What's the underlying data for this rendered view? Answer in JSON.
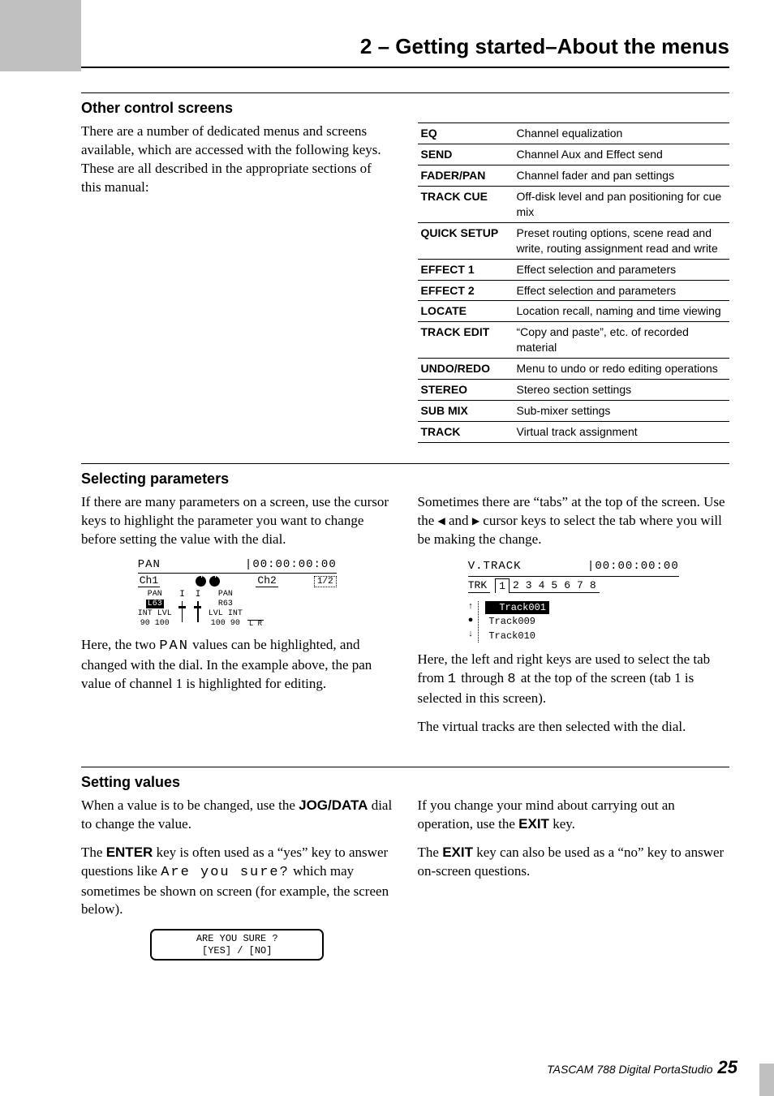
{
  "header": {
    "title": "2 – Getting started–About the menus"
  },
  "section_other": {
    "heading": "Other control screens",
    "intro": "There are a number of dedicated menus and screens available, which are accessed with the following keys. These are all described in the appropriate sections of this manual:"
  },
  "menu_table": [
    {
      "key": "EQ",
      "desc": "Channel equalization"
    },
    {
      "key": "SEND",
      "desc": "Channel Aux and Effect send"
    },
    {
      "key": "FADER/PAN",
      "desc": "Channel fader and pan settings"
    },
    {
      "key": "TRACK CUE",
      "desc": "Off-disk level and pan positioning for cue mix"
    },
    {
      "key": "QUICK SETUP",
      "desc": "Preset routing options, scene read and write, routing assignment read and write"
    },
    {
      "key": "EFFECT 1",
      "desc": "Effect selection and parameters"
    },
    {
      "key": "EFFECT 2",
      "desc": "Effect selection and parameters"
    },
    {
      "key": "LOCATE",
      "desc": "Location recall, naming and time viewing"
    },
    {
      "key": "TRACK EDIT",
      "desc": "“Copy and paste”, etc. of recorded material"
    },
    {
      "key": "UNDO/REDO",
      "desc": "Menu to undo or redo editing operations"
    },
    {
      "key": "STEREO",
      "desc": "Stereo section settings"
    },
    {
      "key": "SUB MIX",
      "desc": "Sub-mixer settings"
    },
    {
      "key": "TRACK",
      "desc": "Virtual track assignment"
    }
  ],
  "section_selecting": {
    "heading": "Selecting parameters",
    "left_p1": "If there are many parameters on a screen, use the cursor keys to highlight the parameter you want to change before setting the value with the dial.",
    "left_p2_a": "Here, the two ",
    "left_p2_mono": "PAN",
    "left_p2_b": " values can be highlighted, and changed with the dial. In the example above, the pan value of channel 1 is highlighted for editing.",
    "right_p1": "Sometimes there are “tabs” at the top of the screen. Use the ",
    "right_p1_mid": " and ",
    "right_p1_end": " cursor keys to select the tab where you will be making the change.",
    "right_p2_a": "Here, the left and right keys are used to select the tab from ",
    "right_p2_mono1": "1",
    "right_p2_mid": " through ",
    "right_p2_mono2": "8",
    "right_p2_b": " at the top of the screen (tab 1 is selected in this screen).",
    "right_p3": "The virtual tracks are then selected with the dial."
  },
  "pan_lcd": {
    "title": "PAN",
    "time": "|00:00:00:00",
    "ch1": "Ch1",
    "ch2": "Ch2",
    "page": "1/2",
    "pan_label": "PAN",
    "l63": "L63",
    "r63": "R63",
    "int_l": "INT",
    "lvl_l": "LVL",
    "ninety_l": "90",
    "hundred_l": "100",
    "lvl_r": "LVL",
    "int_r": "INT",
    "hundred_r": "100",
    "ninety_r": "90",
    "lr": "L R",
    "i_label": "I"
  },
  "vtrack_lcd": {
    "title": "V.TRACK",
    "time": "|00:00:00:00",
    "trk": "TRK",
    "tabs": [
      "1",
      "2",
      "3",
      "4",
      "5",
      "6",
      "7",
      "8"
    ],
    "rows": [
      "Track001",
      "Track009",
      "Track010"
    ]
  },
  "section_setting": {
    "heading": "Setting values",
    "left_p1_a": "When a value is to be changed, use the ",
    "left_p1_key": "JOG/DATA",
    "left_p1_b": " dial to change the value.",
    "left_p2_a": "The ",
    "left_p2_key": "ENTER",
    "left_p2_b": " key is often used as a “yes” key to answer questions like ",
    "left_p2_mono": "Are you sure?",
    "left_p2_c": " which may sometimes be shown on screen (for example, the screen below).",
    "right_p1_a": "If you change your mind about carrying out an operation, use the ",
    "right_p1_key": "EXIT",
    "right_p1_b": " key.",
    "right_p2_a": "The ",
    "right_p2_key": "EXIT",
    "right_p2_b": " key can also be used as a “no” key to answer on-screen questions."
  },
  "sure_box": {
    "line1": "ARE YOU SURE ?",
    "line2": "[YES] / [NO]"
  },
  "footer": {
    "product": "TASCAM 788 Digital PortaStudio",
    "page": "25"
  }
}
